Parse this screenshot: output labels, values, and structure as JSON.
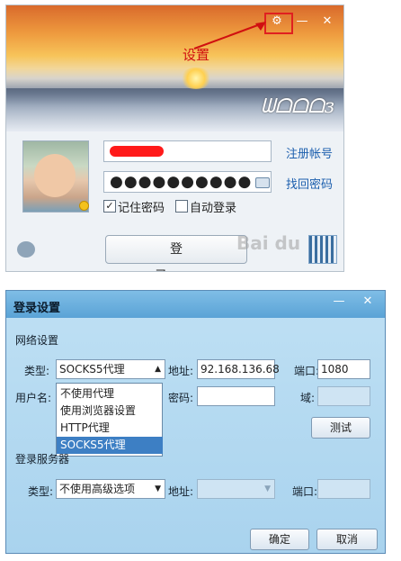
{
  "login": {
    "annotation": "设置",
    "signature": "ᗯᗝᗝᗝɜ",
    "password_mask": "●●●●●●●●●●",
    "register_link": "注册帐号",
    "recover_link": "找回密码",
    "remember_password": {
      "label": "记住密码",
      "checked": true
    },
    "auto_login": {
      "label": "自动登录",
      "checked": false
    },
    "login_button": "登 录",
    "watermark": "Bai du"
  },
  "dialog": {
    "title": "登录设置",
    "network_section": "网络设置",
    "type_label": "类型:",
    "type_value": "SOCKS5代理",
    "address_label": "地址:",
    "address_value": "92.168.136.68",
    "port_label": "端口:",
    "port_value": "1080",
    "username_label": "用户名:",
    "password_label": "密码:",
    "domain_label": "域:",
    "proxy_options": [
      "不使用代理",
      "使用浏览器设置",
      "HTTP代理",
      "SOCKS5代理"
    ],
    "selected_option": "SOCKS5代理",
    "test_button": "测试",
    "server_section": "登录服务器",
    "server_type_label": "类型:",
    "server_type_value": "不使用高级选项",
    "server_address_label": "地址:",
    "server_port_label": "端口:",
    "ok_button": "确定",
    "cancel_button": "取消"
  },
  "icons": [
    "settings-gear-icon",
    "minimize-icon",
    "close-icon",
    "dropdown-arrow-icon",
    "keyboard-icon",
    "qr-code-icon",
    "multi-account-icon",
    "red-arrow-icon"
  ],
  "colors": {
    "annotation_red": "#d01010",
    "link_blue": "#1c5fae",
    "selection_blue": "#3d7fc4",
    "dialog_bg": "#a9d3ee"
  }
}
